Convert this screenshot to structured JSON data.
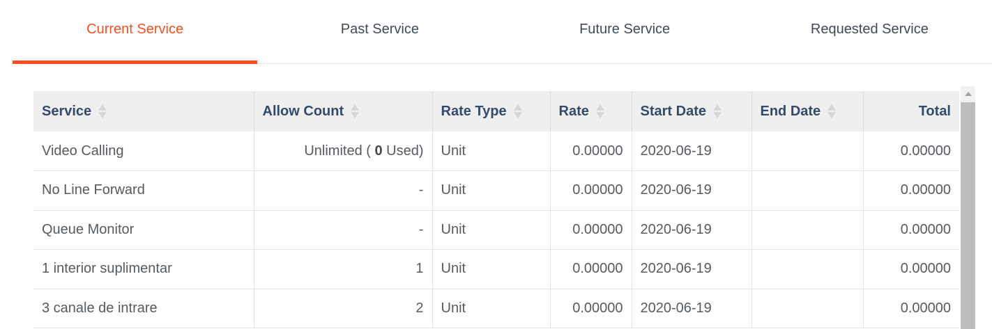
{
  "tabs": [
    {
      "label": "Current Service",
      "active": true
    },
    {
      "label": "Past Service",
      "active": false
    },
    {
      "label": "Future Service",
      "active": false
    },
    {
      "label": "Requested Service",
      "active": false
    }
  ],
  "table": {
    "headers": {
      "service": "Service",
      "allow_count": "Allow Count",
      "rate_type": "Rate Type",
      "rate": "Rate",
      "start_date": "Start Date",
      "end_date": "End Date",
      "total": "Total"
    },
    "rows": [
      {
        "service": "Video Calling",
        "allow_prefix": "Unlimited ( ",
        "allow_used": "0",
        "allow_suffix": " Used)",
        "rate_type": "Unit",
        "rate": "0.00000",
        "start_date": "2020-06-19",
        "end_date": "",
        "total": "0.00000"
      },
      {
        "service": "No Line Forward",
        "allow_count": "-",
        "rate_type": "Unit",
        "rate": "0.00000",
        "start_date": "2020-06-19",
        "end_date": "",
        "total": "0.00000"
      },
      {
        "service": "Queue Monitor",
        "allow_count": "-",
        "rate_type": "Unit",
        "rate": "0.00000",
        "start_date": "2020-06-19",
        "end_date": "",
        "total": "0.00000"
      },
      {
        "service": "1 interior suplimentar",
        "allow_count": "1",
        "rate_type": "Unit",
        "rate": "0.00000",
        "start_date": "2020-06-19",
        "end_date": "",
        "total": "0.00000"
      },
      {
        "service": "3 canale de intrare",
        "allow_count": "2",
        "rate_type": "Unit",
        "rate": "0.00000",
        "start_date": "2020-06-19",
        "end_date": "",
        "total": "0.00000"
      }
    ]
  },
  "colors": {
    "accent": "#f4511e",
    "header_text": "#34496b",
    "header_bg": "#efefef"
  },
  "icons": {
    "sort": "sort-arrows-icon",
    "scroll_up": "scroll-up-arrow-icon"
  }
}
